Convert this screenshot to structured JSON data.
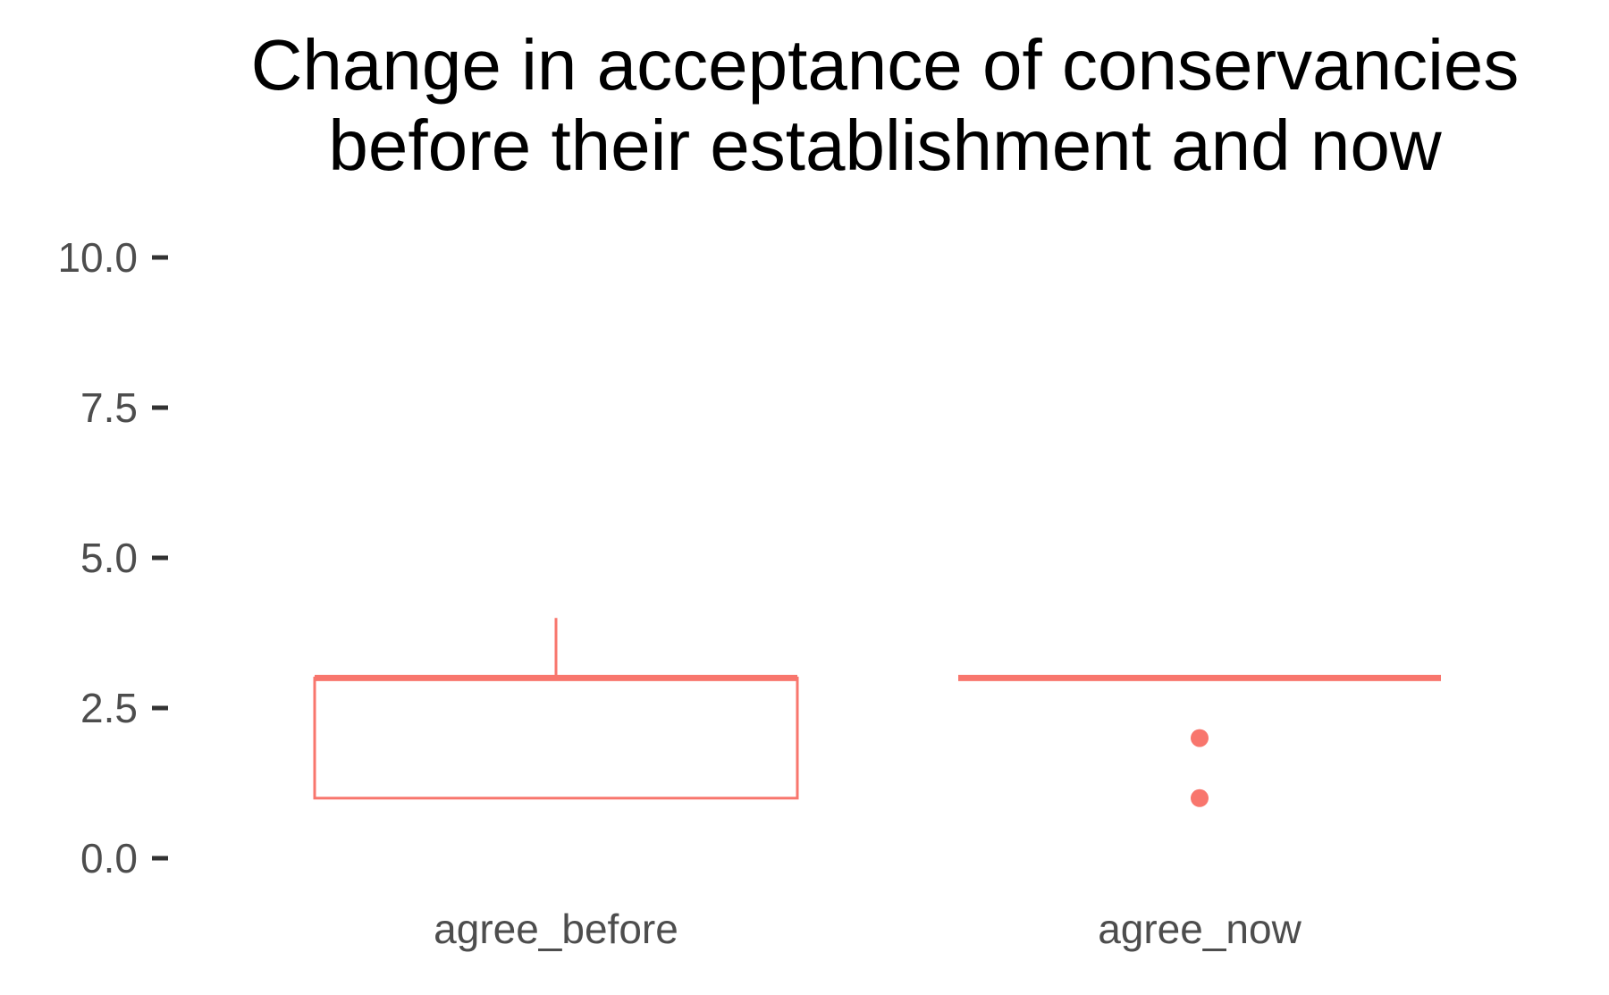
{
  "chart_data": {
    "type": "box",
    "title_lines": [
      "Change in acceptance of conservancies",
      "before their establishment and now"
    ],
    "xlabel": "",
    "ylabel": "",
    "categories": [
      "agree_before",
      "agree_now"
    ],
    "y_ticks": [
      "0.0",
      "2.5",
      "5.0",
      "7.5",
      "10.0"
    ],
    "ylim": [
      0,
      10
    ],
    "grid": false,
    "boxes": [
      {
        "category": "agree_before",
        "whisker_low": 1,
        "q1": 1,
        "median": 3,
        "q3": 3,
        "whisker_high": 4,
        "outliers": []
      },
      {
        "category": "agree_now",
        "whisker_low": 3,
        "q1": 3,
        "median": 3,
        "q3": 3,
        "whisker_high": 3,
        "outliers": [
          1,
          2
        ]
      }
    ],
    "colors": {
      "box": "#f8766d",
      "tick_text": "#4d4d4d",
      "tick_mark": "#333333",
      "title": "#000000"
    }
  }
}
